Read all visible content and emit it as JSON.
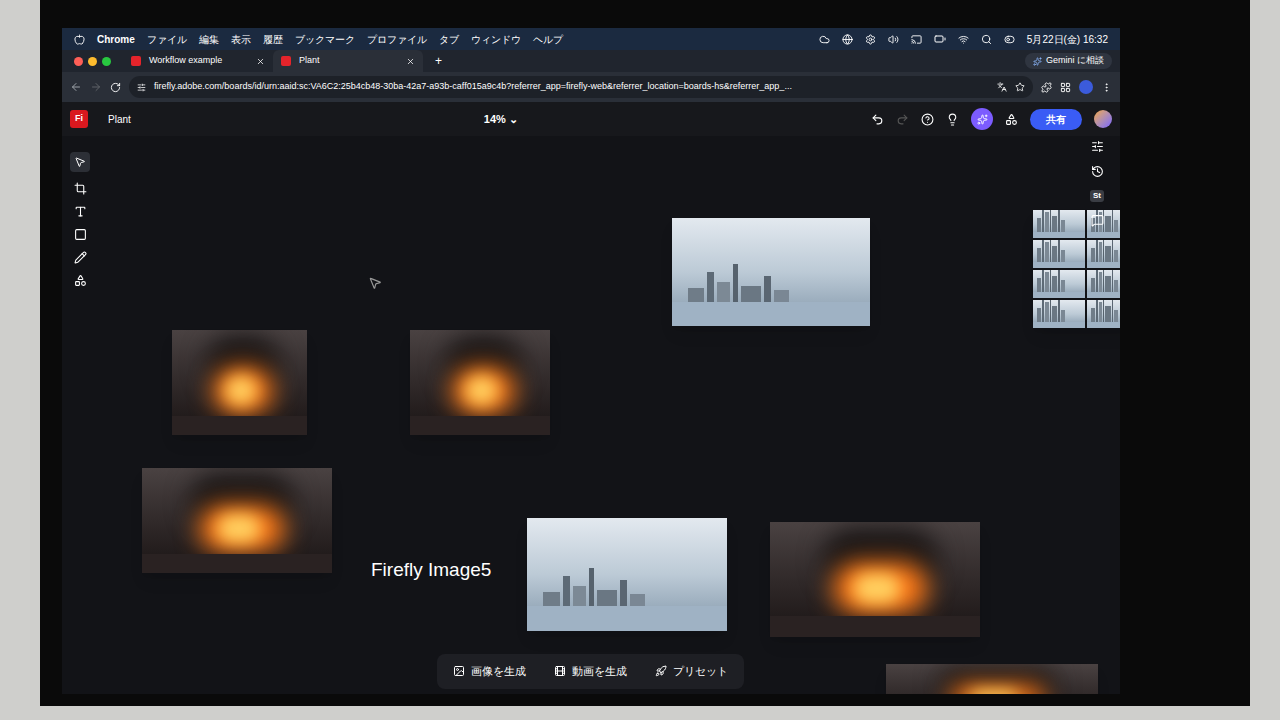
{
  "menubar": {
    "items": [
      "Chrome",
      "ファイル",
      "編集",
      "表示",
      "履歴",
      "ブックマーク",
      "プロファイル",
      "タブ",
      "ウィンドウ",
      "ヘルプ"
    ],
    "clock": "5月22日(金) 16:32",
    "assistant": "Gemini に相談"
  },
  "tabs": [
    {
      "label": "Workflow example",
      "selected": false
    },
    {
      "label": "Plant",
      "selected": true
    }
  ],
  "new_tab": "+",
  "address_bar": {
    "url": "firefly.adobe.com/boards/id/urn:aaid:sc:VA6C2:25b4cb48-30ba-42a7-a93b-caff015a9c4b?referrer_app=firefly-web&referrer_location=boards-hs&referrer_app_..."
  },
  "app": {
    "logo": "Fi",
    "board_title": "Plant",
    "zoom": "14%",
    "share": "共有"
  },
  "right_toolbar": {
    "badge": "St"
  },
  "canvas": {
    "label": "Firefly Image5",
    "images": [
      {
        "kind": "plant"
      },
      {
        "kind": "grid"
      },
      {
        "kind": "fire"
      },
      {
        "kind": "fire"
      },
      {
        "kind": "fire"
      },
      {
        "kind": "plant"
      },
      {
        "kind": "fire"
      },
      {
        "kind": "fire"
      }
    ]
  },
  "bottom_bar": [
    {
      "label": "画像を生成"
    },
    {
      "label": "動画を生成"
    },
    {
      "label": "プリセット"
    }
  ]
}
